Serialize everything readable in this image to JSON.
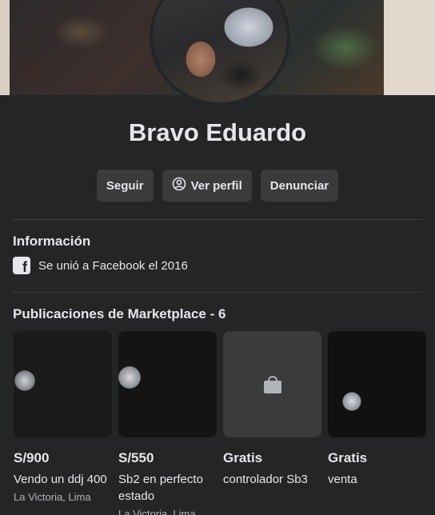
{
  "profile": {
    "name": "Bravo Eduardo"
  },
  "actions": {
    "follow_label": "Seguir",
    "view_profile_label": "Ver perfil",
    "report_label": "Denunciar"
  },
  "info": {
    "title": "Información",
    "joined_text": "Se unió a Facebook el 2016",
    "icon": "facebook-icon"
  },
  "marketplace": {
    "title": "Publicaciones de Marketplace - 6",
    "listings": [
      {
        "price": "S/900",
        "title": "Vendo un ddj 400",
        "location": "La Victoria, Lima"
      },
      {
        "price": "S/550",
        "title": "Sb2 en perfecto estado",
        "location": "La Victoria, Lima"
      },
      {
        "price": "Gratis",
        "title": "controlador Sb3",
        "location": ""
      },
      {
        "price": "Gratis",
        "title": "venta",
        "location": ""
      }
    ]
  },
  "colors": {
    "background": "#242526",
    "button": "#3a3b3c",
    "text": "#e4e6eb",
    "secondary_text": "#b0b3b8"
  }
}
